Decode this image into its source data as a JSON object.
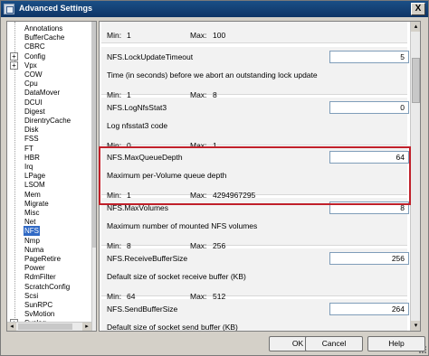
{
  "window": {
    "title": "Advanced Settings",
    "close_label": "X"
  },
  "tree": {
    "items": [
      {
        "label": "Annotations",
        "expandable": false
      },
      {
        "label": "BufferCache",
        "expandable": false
      },
      {
        "label": "CBRC",
        "expandable": false
      },
      {
        "label": "Config",
        "expandable": true
      },
      {
        "label": "Vpx",
        "expandable": true
      },
      {
        "label": "COW",
        "expandable": false
      },
      {
        "label": "Cpu",
        "expandable": false
      },
      {
        "label": "DataMover",
        "expandable": false
      },
      {
        "label": "DCUI",
        "expandable": false
      },
      {
        "label": "Digest",
        "expandable": false
      },
      {
        "label": "DirentryCache",
        "expandable": false
      },
      {
        "label": "Disk",
        "expandable": false
      },
      {
        "label": "FSS",
        "expandable": false
      },
      {
        "label": "FT",
        "expandable": false
      },
      {
        "label": "HBR",
        "expandable": false
      },
      {
        "label": "Irq",
        "expandable": false
      },
      {
        "label": "LPage",
        "expandable": false
      },
      {
        "label": "LSOM",
        "expandable": false
      },
      {
        "label": "Mem",
        "expandable": false
      },
      {
        "label": "Migrate",
        "expandable": false
      },
      {
        "label": "Misc",
        "expandable": false
      },
      {
        "label": "Net",
        "expandable": false
      },
      {
        "label": "NFS",
        "expandable": false,
        "selected": true
      },
      {
        "label": "Nmp",
        "expandable": false
      },
      {
        "label": "Numa",
        "expandable": false
      },
      {
        "label": "PageRetire",
        "expandable": false
      },
      {
        "label": "Power",
        "expandable": false
      },
      {
        "label": "RdmFilter",
        "expandable": false
      },
      {
        "label": "ScratchConfig",
        "expandable": false
      },
      {
        "label": "Scsi",
        "expandable": false
      },
      {
        "label": "SunRPC",
        "expandable": false
      },
      {
        "label": "SvMotion",
        "expandable": false
      },
      {
        "label": "Syslog",
        "expandable": true
      }
    ]
  },
  "settings": {
    "min_label": "Min:",
    "max_label": "Max:",
    "top": {
      "min": "1",
      "max": "100"
    },
    "items": [
      {
        "name": "NFS.LockUpdateTimeout",
        "value": "5",
        "description": "Time (in seconds) before we abort an outstanding lock update",
        "min": "1",
        "max": "8"
      },
      {
        "name": "NFS.LogNfsStat3",
        "value": "0",
        "description": "Log nfsstat3 code",
        "min": "0",
        "max": "1"
      },
      {
        "name": "NFS.MaxQueueDepth",
        "value": "64",
        "description": "Maximum per-Volume queue depth",
        "min": "1",
        "max": "4294967295"
      },
      {
        "name": "NFS.MaxVolumes",
        "value": "8",
        "description": "Maximum number of mounted NFS volumes",
        "min": "8",
        "max": "256"
      },
      {
        "name": "NFS.ReceiveBufferSize",
        "value": "256",
        "description": "Default size of socket receive buffer (KB)",
        "min": "64",
        "max": "512"
      },
      {
        "name": "NFS.SendBufferSize",
        "value": "264",
        "description": "Default size of socket send buffer (KB)",
        "min": "",
        "max": ""
      }
    ]
  },
  "buttons": {
    "ok": "OK",
    "cancel": "Cancel",
    "help": "Help"
  },
  "colors": {
    "titlebar": "#0f3566",
    "selection": "#316ac5",
    "highlight_border": "#c0202a"
  }
}
